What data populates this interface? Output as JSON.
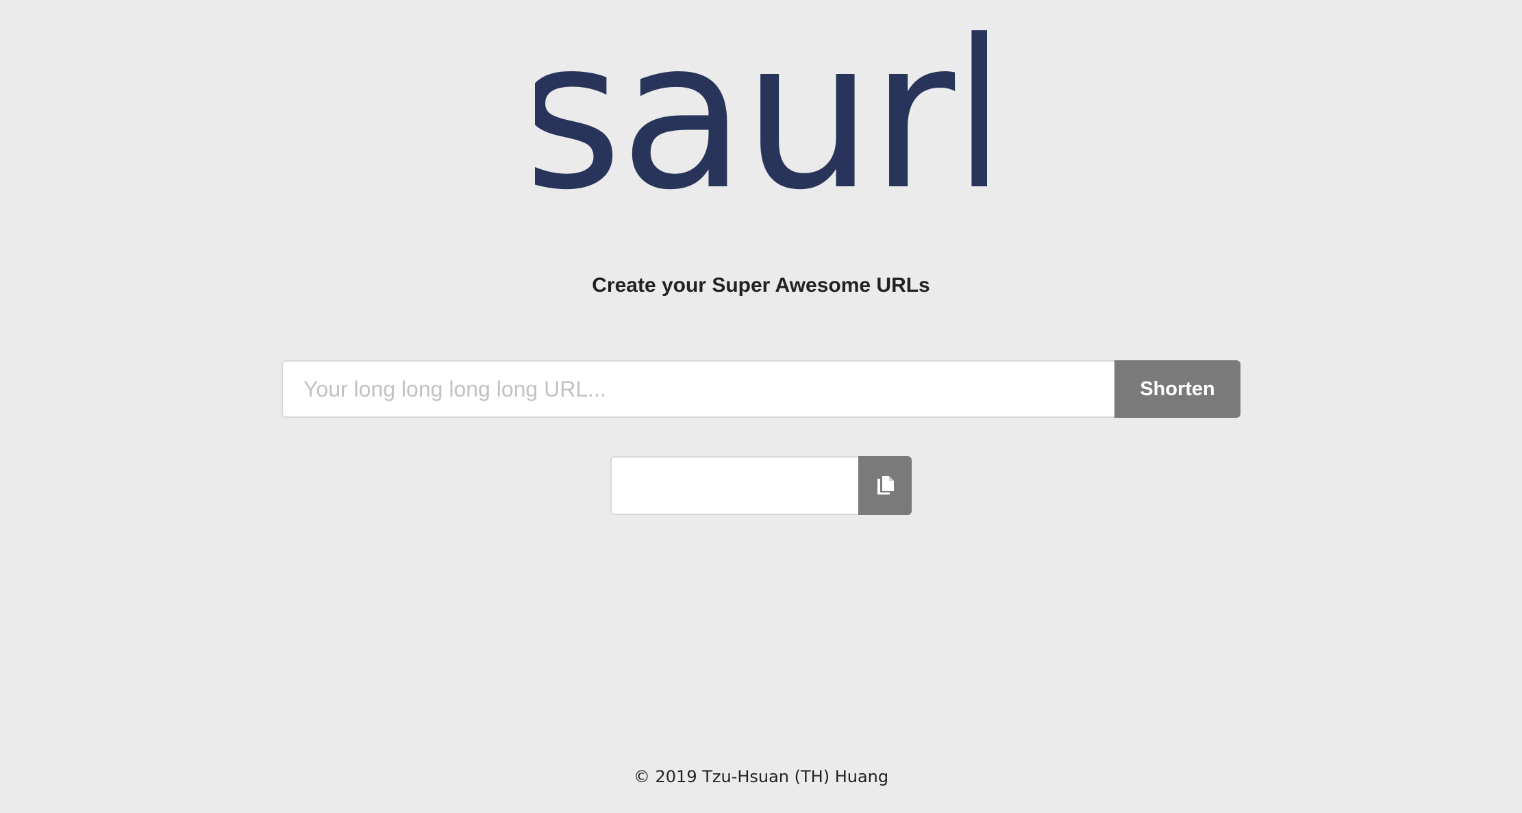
{
  "brand": {
    "logo_text": "saurl",
    "logo_color": "#29345a"
  },
  "tagline": "Create your Super Awesome URLs",
  "shorten_form": {
    "url_placeholder": "Your long long long long URL...",
    "url_value": "",
    "shorten_label": "Shorten"
  },
  "result": {
    "short_url_value": "",
    "copy_icon": "copy-icon"
  },
  "footer": {
    "copyright": "© 2019 Tzu-Hsuan (TH) Huang"
  },
  "colors": {
    "background": "#ebebeb",
    "button": "#7a7a7a",
    "button_text": "#ffffff",
    "text": "#222222",
    "placeholder": "#c2c2c2"
  }
}
